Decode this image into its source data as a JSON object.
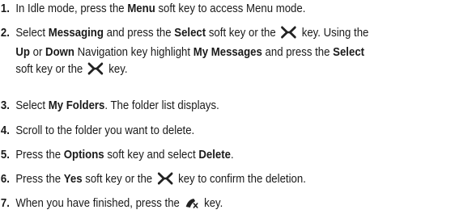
{
  "steps": [
    {
      "number": "1.",
      "lines": [
        [
          "In Idle mode, press the ",
          "Menu",
          " soft key to access Menu mode."
        ]
      ]
    },
    {
      "number": "2.",
      "lines": [
        [
          "Select ",
          "Messaging",
          " and press the ",
          "Select",
          " soft key or the ",
          "",
          " key. Using the"
        ],
        [
          "",
          "Up",
          " or ",
          "Down",
          " Navigation key highlight ",
          "My Messages",
          " and press the ",
          "Select"
        ],
        [
          "soft key or the ",
          "",
          " key."
        ]
      ]
    },
    {
      "number": "3.",
      "lines": [
        [
          "Select ",
          "My Folders",
          ". The folder list displays."
        ]
      ]
    },
    {
      "number": "4.",
      "lines": [
        [
          "Scroll to the folder you want to delete."
        ]
      ]
    },
    {
      "number": "5.",
      "lines": [
        [
          "Press the ",
          "Options",
          " soft key and select ",
          "Delete",
          "."
        ]
      ]
    },
    {
      "number": "6.",
      "lines": [
        [
          "Press the ",
          "Yes",
          " soft key or the ",
          "",
          " key to confirm the deletion."
        ]
      ]
    },
    {
      "number": "7.",
      "lines": [
        [
          "When you have finished, press the ",
          "",
          " key."
        ]
      ]
    }
  ],
  "icons": {
    "select": "ok-x-key-icon",
    "end": "end-call-key-icon"
  }
}
